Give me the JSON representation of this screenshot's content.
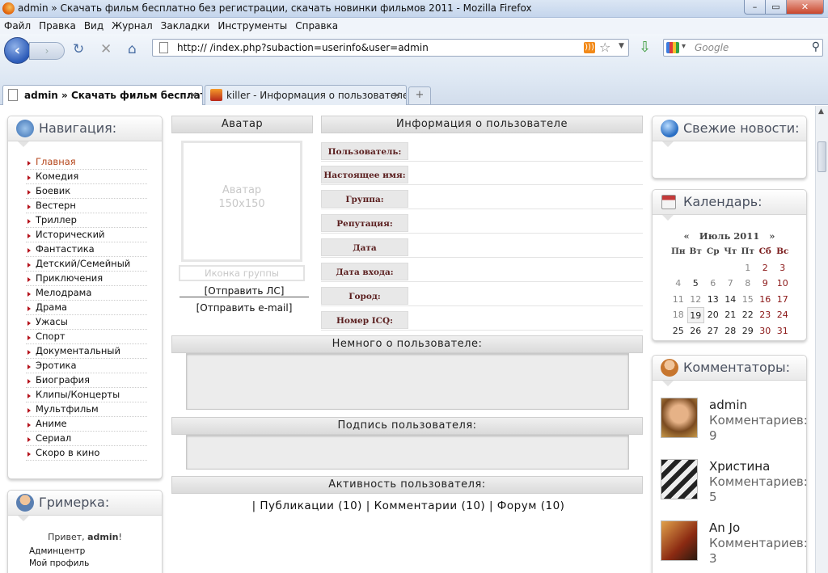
{
  "window": {
    "title": "admin » Скачать фильм бесплатно без регистрации, скачать новинки фильмов 2011 - Mozilla Firefox",
    "min": "–",
    "max": "▭",
    "close": "✕"
  },
  "menu": [
    "Файл",
    "Правка",
    "Вид",
    "Журнал",
    "Закладки",
    "Инструменты",
    "Справка"
  ],
  "toolbar": {
    "back": "‹",
    "forward": "›",
    "reload": "↻",
    "stop": "✕",
    "home": "⌂",
    "url": "http://                          /index.php?subaction=userinfo&user=admin",
    "rss": ")))",
    "star": "☆",
    "drop": "▼",
    "download": "⇩",
    "search_placeholder": "Google",
    "search_engine": "▾",
    "search_go": "⚲"
  },
  "tabs": [
    {
      "label": "admin » Скачать фильм бесплат...",
      "close": "✕"
    },
    {
      "label": "killer - Информация о пользователе",
      "close": "✕"
    }
  ],
  "newtab": "+",
  "left": {
    "nav_title": "Навигация:",
    "nav_items": [
      "Главная",
      "Комедия",
      "Боевик",
      "Вестерн",
      "Триллер",
      "Исторический",
      "Фантастика",
      "Детский/Семейный",
      "Приключения",
      "Мелодрама",
      "Драма",
      "Ужасы",
      "Спорт",
      "Документальный",
      "Эротика",
      "Биография",
      "Клипы/Концерты",
      "Мультфильм",
      "Аниме",
      "Сериал",
      "Скоро в кино"
    ],
    "grim_title": "Гримерка:",
    "grim_greet_prefix": "Привет, ",
    "grim_user": "admin",
    "grim_greet_suffix": "!",
    "grim_links": [
      "Админцентр",
      "Мой профиль"
    ]
  },
  "profile": {
    "avatar_header": "Аватар",
    "avatar_placeholder_line1": "Аватар",
    "avatar_placeholder_line2": "150x150",
    "group_icon": "Иконка группы",
    "send_pm": "[Отправить ЛС]",
    "send_email": "[Отправить e-mail]",
    "info_header": "Информация о пользователе",
    "fields": [
      "Пользователь:",
      "Настоящее имя:",
      "Группа:",
      "Репутация:",
      "Дата регистрации:",
      "Дата входа:",
      "Город:",
      "Номер ICQ:"
    ],
    "about_header": "Немного о пользователе:",
    "signature_header": "Подпись пользователя:",
    "activity_header": "Активность пользователя:",
    "activity_text": "| Публикации (10) | Комментарии (10) | Форум (10)"
  },
  "right": {
    "news_title": "Свежие новости:",
    "cal_title": "Календарь:",
    "cal_prev": "«",
    "cal_month": "Июль 2011",
    "cal_next": "»",
    "cal_days": [
      "Пн",
      "Вт",
      "Ср",
      "Чт",
      "Пт",
      "Сб",
      "Вс"
    ],
    "cal_cells": [
      "",
      "",
      "",
      "",
      "1",
      "2",
      "3",
      "4",
      "5",
      "6",
      "7",
      "8",
      "9",
      "10",
      "11",
      "12",
      "13",
      "14",
      "15",
      "16",
      "17",
      "18",
      "19",
      "20",
      "21",
      "22",
      "23",
      "24",
      "25",
      "26",
      "27",
      "28",
      "29",
      "30",
      "31"
    ],
    "comm_title": "Комментаторы:",
    "commenters": [
      {
        "name": "admin",
        "label": "Комментариев:",
        "count": "9"
      },
      {
        "name": "Христина",
        "label": "Комментариев:",
        "count": "5"
      },
      {
        "name": "An Jo",
        "label": "Комментариев:",
        "count": "3"
      }
    ]
  }
}
